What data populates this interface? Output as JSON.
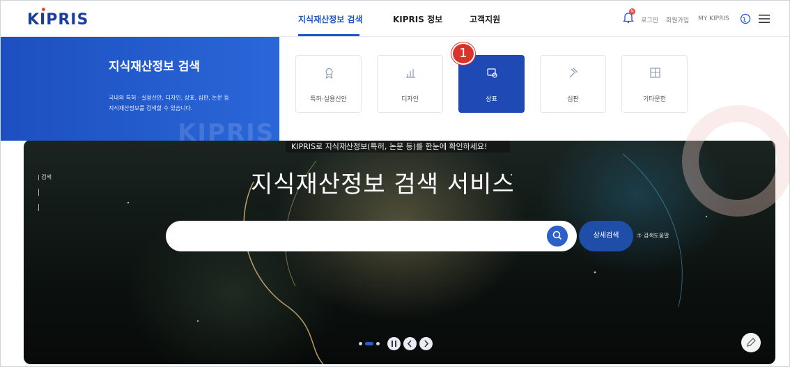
{
  "header": {
    "logo": "KIPRIS",
    "nav": [
      "지식재산정보 검색",
      "KIPRIS 정보",
      "고객지원"
    ],
    "bell_badge": "N",
    "util": [
      "로그인",
      "회원가입",
      "MY KIPRIS"
    ]
  },
  "dropdown": {
    "title": "지식재산정보 검색",
    "desc": [
      "국내외 특허 · 실용신안, 디자인, 상표, 심판, 논문 등",
      "지식재산정보를 검색할 수 있습니다."
    ],
    "watermark": "KIPRIS",
    "cards": [
      "특허·실용신안",
      "디자인",
      "상표",
      "심판",
      "기타문헌"
    ],
    "active_card": "상표"
  },
  "annotation": {
    "marker": "1"
  },
  "banner": {
    "tagline": "KIPRIS로 지식재산정보(특허, 논문 등)를 한눈에 확인하세요!",
    "title": "지식재산정보 검색 서비스",
    "side_label": "| 검색",
    "search_placeholder": "",
    "advanced_search": "상세검색",
    "help": "⑦ 검색도움말"
  },
  "colors": {
    "brand": "#1f56c7",
    "accent_red": "#d9342b"
  }
}
